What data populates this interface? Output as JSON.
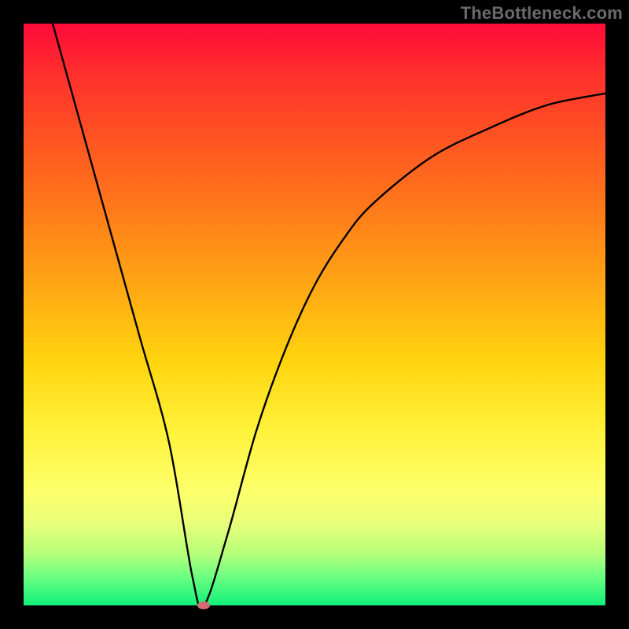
{
  "watermark": "TheBottleneck.com",
  "chart_data": {
    "type": "line",
    "title": "",
    "xlabel": "",
    "ylabel": "",
    "xlim": [
      0,
      100
    ],
    "ylim": [
      0,
      100
    ],
    "grid": false,
    "legend": false,
    "series": [
      {
        "name": "curve",
        "x": [
          5,
          10,
          15,
          20,
          25,
          29,
          31,
          35,
          40,
          45,
          50,
          55,
          60,
          70,
          80,
          90,
          100
        ],
        "y": [
          100,
          82,
          64,
          46,
          28,
          5,
          0,
          12,
          30,
          44,
          55,
          63,
          69,
          77,
          82,
          86,
          88
        ]
      }
    ],
    "marker": {
      "x": 31,
      "y": 0,
      "color": "#d36b72"
    },
    "gradient_stops": [
      {
        "pos": 0,
        "color": "#ff0a3a"
      },
      {
        "pos": 20,
        "color": "#ff5522"
      },
      {
        "pos": 45,
        "color": "#ffa714"
      },
      {
        "pos": 70,
        "color": "#fff23a"
      },
      {
        "pos": 100,
        "color": "#11f07a"
      }
    ]
  }
}
